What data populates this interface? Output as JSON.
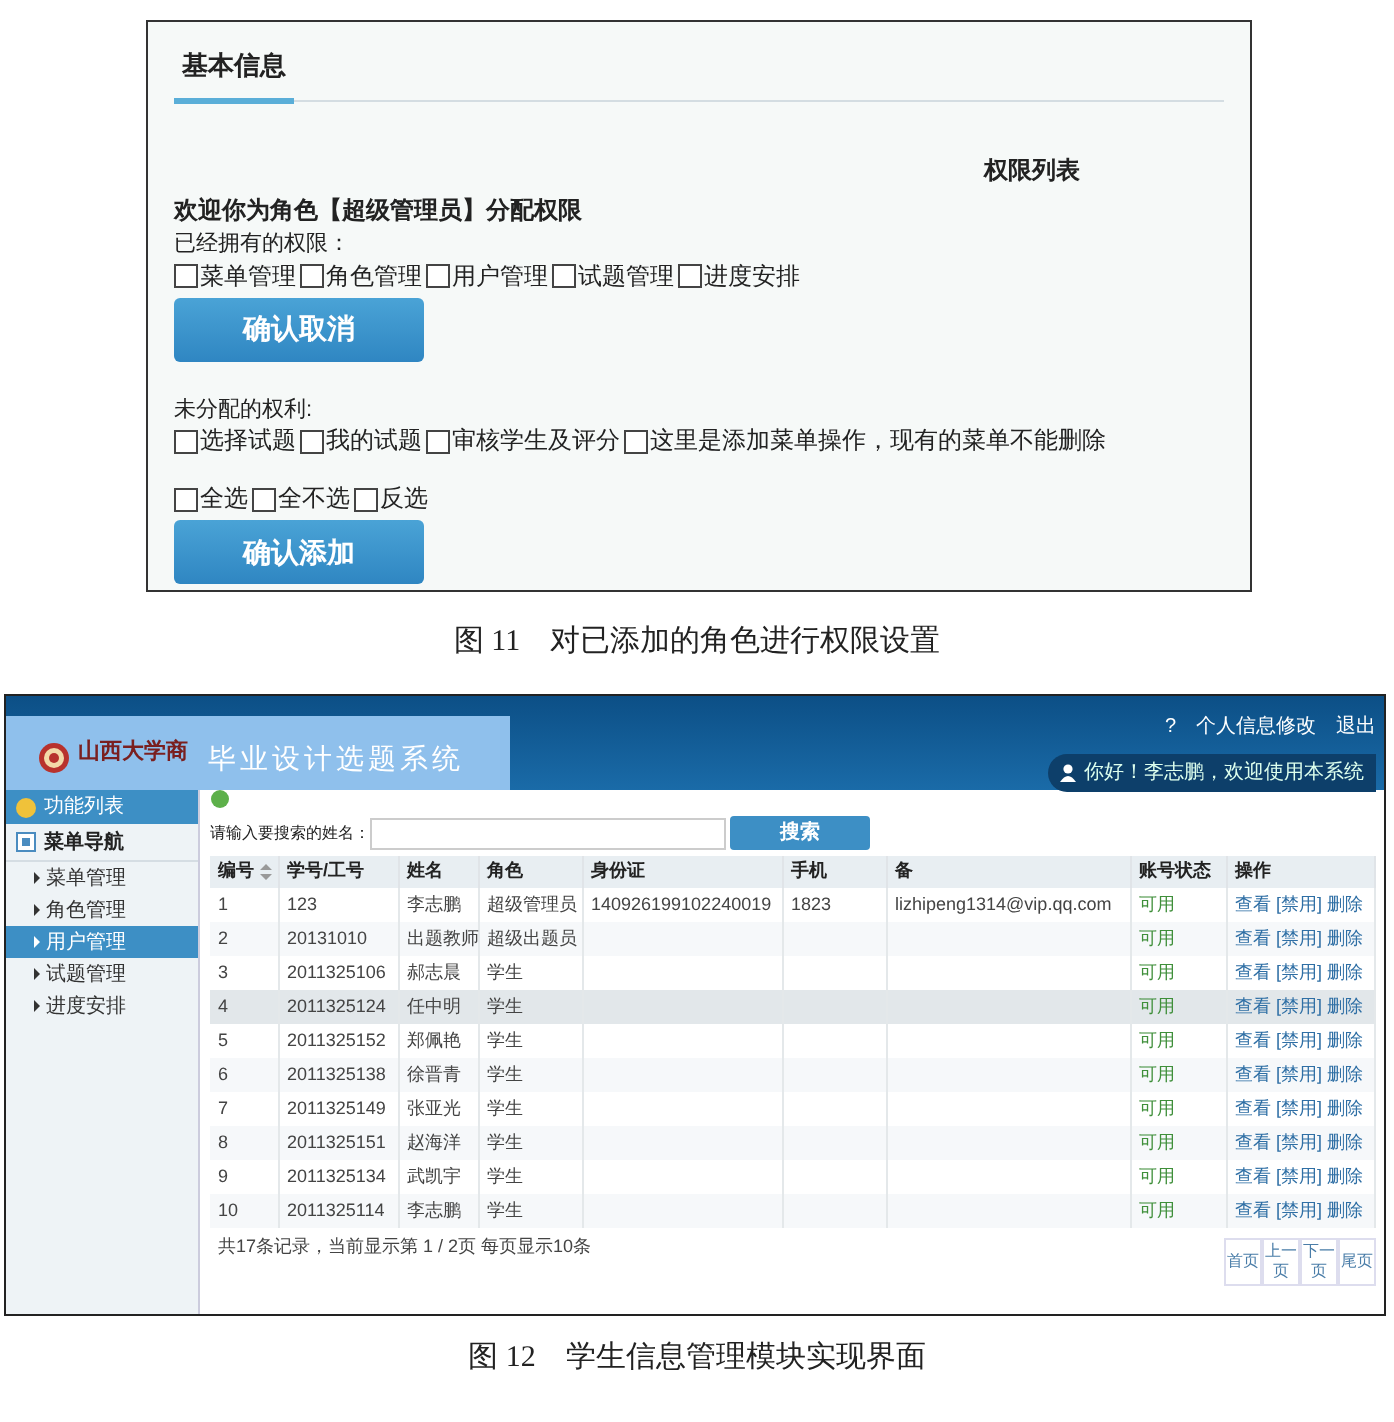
{
  "panel": {
    "tabs": [
      {
        "label": "基本信息",
        "selected": true
      }
    ],
    "list_title": "权限列表",
    "heading": "欢迎你为角色【超级管理员】分配权限",
    "owned_label": "已经拥有的权限：",
    "owned": [
      {
        "label": "菜单管理",
        "checked": false
      },
      {
        "label": "角色管理",
        "checked": false
      },
      {
        "label": "用户管理",
        "checked": false
      },
      {
        "label": "试题管理",
        "checked": false
      },
      {
        "label": "进度安排",
        "checked": false
      }
    ],
    "cancel_button": "确认取消",
    "unassigned_label": "未分配的权利:",
    "unassigned": [
      {
        "label": "选择试题",
        "checked": false
      },
      {
        "label": "我的试题",
        "checked": false
      },
      {
        "label": "审核学生及评分",
        "checked": false
      },
      {
        "label": "这里是添加菜单操作，现有的菜单不能删除",
        "checked": false
      }
    ],
    "select_options": [
      {
        "label": "全选",
        "checked": false
      },
      {
        "label": "全不选",
        "checked": false
      },
      {
        "label": "反选",
        "checked": false
      }
    ],
    "add_button": "确认添加"
  },
  "caption_1": "图 11　对已添加的角色进行权限设置",
  "app": {
    "logo_text": "山西大学商",
    "title": "毕业设计选题系统",
    "top_links": [
      "?",
      "个人信息修改",
      "退出"
    ],
    "greeting": "你好！李志鹏，欢迎使用本系统",
    "sidebar": {
      "header": "功能列表",
      "group": "菜单导航",
      "items": [
        {
          "label": "菜单管理",
          "selected": false
        },
        {
          "label": "角色管理",
          "selected": false
        },
        {
          "label": "用户管理",
          "selected": true
        },
        {
          "label": "试题管理",
          "selected": false
        },
        {
          "label": "进度安排",
          "selected": false
        }
      ]
    },
    "search": {
      "label": "请输入要搜索的姓名：",
      "button": "搜索"
    },
    "table": {
      "columns": [
        "编号",
        "学号/工号",
        "姓名",
        "角色",
        "身份证",
        "手机",
        "备",
        "账号状态",
        "操作"
      ],
      "rows": [
        {
          "no": "1",
          "number": "123",
          "name": "李志鹏",
          "role": "超级管理员",
          "id_card": "140926199102240019",
          "phone": "1823",
          "email": "lizhipeng1314@vip.qq.com",
          "status": "可用",
          "actions": [
            "查看",
            "[禁用]",
            "删除"
          ],
          "highlighted": false
        },
        {
          "no": "2",
          "number": "20131010",
          "name": "出题教师",
          "role": "超级出题员",
          "status": "可用",
          "actions": [
            "查看",
            "[禁用]",
            "删除"
          ],
          "highlighted": false
        },
        {
          "no": "3",
          "number": "2011325106",
          "name": "郝志晨",
          "role": "学生",
          "status": "可用",
          "actions": [
            "查看",
            "[禁用]",
            "删除"
          ],
          "highlighted": false
        },
        {
          "no": "4",
          "number": "2011325124",
          "name": "任中明",
          "role": "学生",
          "status": "可用",
          "actions": [
            "查看",
            "[禁用]",
            "删除"
          ],
          "highlighted": true
        },
        {
          "no": "5",
          "number": "2011325152",
          "name": "郑佩艳",
          "role": "学生",
          "status": "可用",
          "actions": [
            "查看",
            "[禁用]",
            "删除"
          ],
          "highlighted": false
        },
        {
          "no": "6",
          "number": "2011325138",
          "name": "徐晋青",
          "role": "学生",
          "status": "可用",
          "actions": [
            "查看",
            "[禁用]",
            "删除"
          ],
          "highlighted": false
        },
        {
          "no": "7",
          "number": "2011325149",
          "name": "张亚光",
          "role": "学生",
          "status": "可用",
          "actions": [
            "查看",
            "[禁用]",
            "删除"
          ],
          "highlighted": false
        },
        {
          "no": "8",
          "number": "2011325151",
          "name": "赵海洋",
          "role": "学生",
          "status": "可用",
          "actions": [
            "查看",
            "[禁用]",
            "删除"
          ],
          "highlighted": false
        },
        {
          "no": "9",
          "number": "2011325134",
          "name": "武凯宇",
          "role": "学生",
          "status": "可用",
          "actions": [
            "查看",
            "[禁用]",
            "删除"
          ],
          "highlighted": false
        },
        {
          "no": "10",
          "number": "2011325114",
          "name": "李志鹏",
          "role": "学生",
          "status": "可用",
          "actions": [
            "查看",
            "[禁用]",
            "删除"
          ],
          "highlighted": false
        }
      ]
    },
    "footer": "共17条记录，当前显示第 1 / 2页 每页显示10条",
    "pagination": [
      "首页",
      "上一页",
      "下一页",
      "尾页"
    ]
  },
  "caption_2": "图 12　学生信息管理模块实现界面"
}
